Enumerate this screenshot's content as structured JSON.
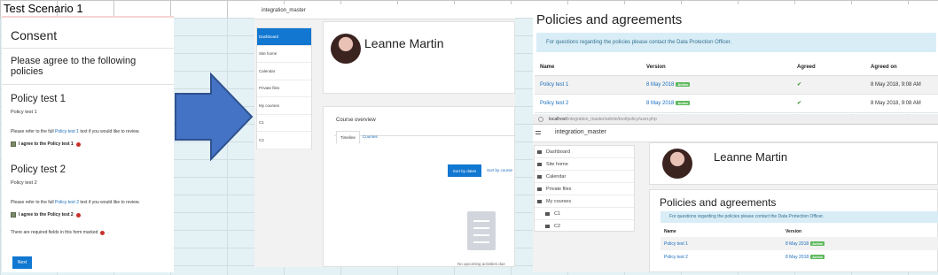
{
  "caption": "Test Scenario 1",
  "consent": {
    "title": "Consent",
    "subtitle": "Please agree to the following policies",
    "policies": [
      {
        "title": "Policy test 1",
        "summary": "Policy test 1",
        "review_prefix": "Please refer to the full",
        "review_link": "Policy test 1",
        "review_suffix": "text if you would like to review.",
        "agree_label": "I agree to the Policy test 1"
      },
      {
        "title": "Policy test 2",
        "summary": "Policy test 2",
        "review_prefix": "Please refer to the full",
        "review_link": "Policy test 2",
        "review_suffix": "text if you would like to review.",
        "agree_label": "I agree to the Policy test 2"
      }
    ],
    "required_note": "There are required fields in this form marked",
    "required_note_end": ".",
    "next_label": "Next"
  },
  "dashboard": {
    "site_name": "integration_master",
    "nav": [
      "Dashboard",
      "Site home",
      "Calendar",
      "Private files",
      "My courses",
      "C1",
      "C2"
    ],
    "user_name": "Leanne Martin",
    "course_overview": "Course overview",
    "tabs": {
      "timeline": "Timeline",
      "courses": "Courses"
    },
    "sort_dates": "Sort by dates",
    "sort_courses": "Sort by course",
    "no_activities": "No upcoming activities due"
  },
  "policies_page": {
    "title": "Policies and agreements",
    "info": "For questions regarding the policies please contact the Data Protection Officer.",
    "headers": [
      "Name",
      "Version",
      "Agreed",
      "Agreed on"
    ],
    "rows": [
      {
        "name": "Policy test 1",
        "version": "8 May 2018",
        "badge": "Active",
        "agreed": "✔",
        "agreed_on": "8 May 2018, 9:08 AM"
      },
      {
        "name": "Policy test 2",
        "version": "8 May 2018",
        "badge": "Active",
        "agreed": "✔",
        "agreed_on": "8 May 2018, 9:08 AM"
      }
    ]
  },
  "browser": {
    "url_host": "localhost",
    "url_path": "/integration_master/admin/tool/policy/user.php",
    "site_name": "integration_master",
    "nav": [
      "Dashboard",
      "Site home",
      "Calendar",
      "Private files",
      "My courses",
      "C1",
      "C2"
    ],
    "user_name": "Leanne Martin",
    "policies_title": "Policies and agreements",
    "info": "For questions regarding the policies please contact the Data Protection Officer.",
    "headers": [
      "Name",
      "Version"
    ],
    "rows": [
      {
        "name": "Policy test 1",
        "version": "8 May 2018",
        "badge": "Active"
      },
      {
        "name": "Policy test 2",
        "version": "8 May 2018",
        "badge": "Active"
      }
    ]
  },
  "colors": {
    "primary": "#1177d1",
    "info_bg": "#d9edf7",
    "badge": "#5cb85c",
    "required": "#c9302c"
  }
}
